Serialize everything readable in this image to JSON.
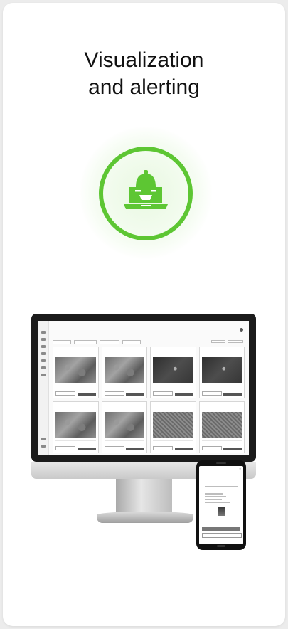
{
  "hero": {
    "title_line1": "Visualization",
    "title_line2": "and alerting",
    "icon": "alarm-bell-icon",
    "accent_color": "#5dc633"
  },
  "dashboard": {
    "tiles": [
      {
        "image": "aerial-photo"
      },
      {
        "image": "aerial-photo"
      },
      {
        "image": "thermal-photo"
      },
      {
        "image": "thermal-photo"
      },
      {
        "image": "aerial-photo"
      },
      {
        "image": "aerial-photo"
      },
      {
        "image": "map"
      },
      {
        "image": "map"
      }
    ]
  },
  "phone": {
    "icon": "close-icon"
  }
}
